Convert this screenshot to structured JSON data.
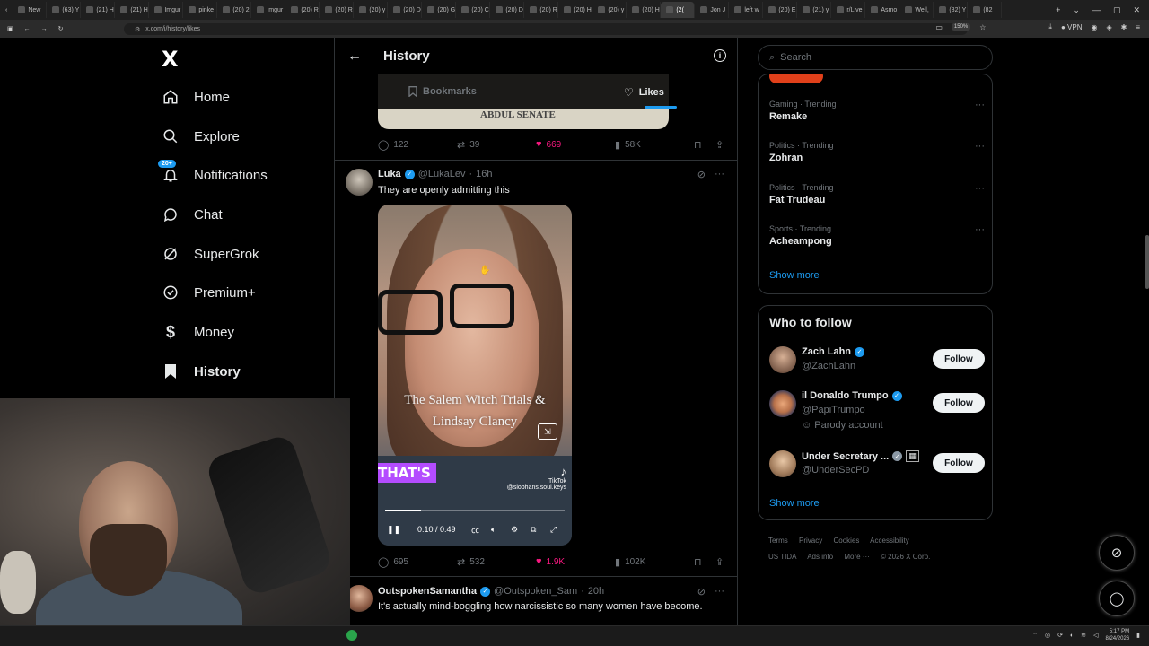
{
  "browser": {
    "tabs": [
      "New",
      "(63) Y",
      "(21) H",
      "(21) H",
      "Imgur",
      "pinke",
      "(20) 2",
      "Imgur",
      "(20) R",
      "(20) R",
      "(20) y",
      "(20) D",
      "(20) G",
      "(20) C",
      "(20) D",
      "(20) R",
      "(20) H",
      "(20) y",
      "(20) H",
      "(2(",
      "Jon J",
      "left w",
      "(20) E",
      "(21) y",
      "r/Live",
      "Asmo",
      "Well,",
      "(82) Y",
      "(82"
    ],
    "active_tab_index": 19,
    "url": "x.com/i/history/likes",
    "zoom": "150%",
    "vpn_label": "VPN"
  },
  "nav": {
    "logo": "X",
    "items": [
      {
        "label": "Home",
        "icon": "home-icon"
      },
      {
        "label": "Explore",
        "icon": "search-icon"
      },
      {
        "label": "Notifications",
        "icon": "bell-icon",
        "badge": "20+"
      },
      {
        "label": "Chat",
        "icon": "chat-icon"
      },
      {
        "label": "SuperGrok",
        "icon": "grok-icon"
      },
      {
        "label": "Premium+",
        "icon": "premium-icon"
      },
      {
        "label": "Money",
        "icon": "dollar-icon"
      },
      {
        "label": "History",
        "icon": "bookmark-icon",
        "active": true
      }
    ]
  },
  "header": {
    "title": "History",
    "tabs": [
      {
        "label": "Bookmarks",
        "active": false
      },
      {
        "label": "Likes",
        "active": true
      }
    ]
  },
  "prev_post": {
    "media_text": "ABDUL SENATE",
    "replies": "122",
    "reposts": "39",
    "likes": "669",
    "views": "58K"
  },
  "post": {
    "name": "Luka",
    "handle": "@LukaLev",
    "time": "16h",
    "text": "They are openly admitting this",
    "video": {
      "caption_line1": "The Salem Witch Trials &",
      "caption_line2": "Lindsay Clancy",
      "overlay": "THAT'S",
      "tiktok_label": "TikTok",
      "tiktok_user": "@siobhans.soul.keys",
      "time": "0:10 / 0:49",
      "progress": 0.2
    },
    "replies": "695",
    "reposts": "532",
    "likes": "1.9K",
    "views": "102K"
  },
  "next_post": {
    "name": "OutspokenSamantha",
    "handle": "@Outspoken_Sam",
    "time": "20h",
    "text": "It's actually mind-boggling how narcissistic so many women have become."
  },
  "sidebar": {
    "search_placeholder": "Search",
    "trends": [
      {
        "category": "Gaming · Trending",
        "name": "Remake"
      },
      {
        "category": "Politics · Trending",
        "name": "Zohran"
      },
      {
        "category": "Politics · Trending",
        "name": "Fat Trudeau"
      },
      {
        "category": "Sports · Trending",
        "name": "Acheampong"
      }
    ],
    "trends_show_more": "Show more",
    "wtf_title": "Who to follow",
    "accounts": [
      {
        "name": "Zach Lahn",
        "handle": "@ZachLahn",
        "sub": "",
        "follow": "Follow"
      },
      {
        "name": "il Donaldo Trumpo",
        "handle": "@PapiTrumpo",
        "sub": "Parody account",
        "follow": "Follow"
      },
      {
        "name": "Under Secretary ...",
        "handle": "@UnderSecPD",
        "sub": "",
        "follow": "Follow"
      }
    ],
    "wtf_show_more": "Show more",
    "footer": [
      "Terms",
      "Privacy",
      "Cookies",
      "Accessibility",
      "US TIDA",
      "Ads info",
      "More ···",
      "© 2026 X Corp."
    ]
  },
  "taskbar": {
    "time": "5:17 PM",
    "date": "8/24/2026"
  },
  "colors": {
    "accent": "#1d9bf0",
    "like": "#f91880",
    "muted": "#71767b",
    "background": "#000000"
  }
}
